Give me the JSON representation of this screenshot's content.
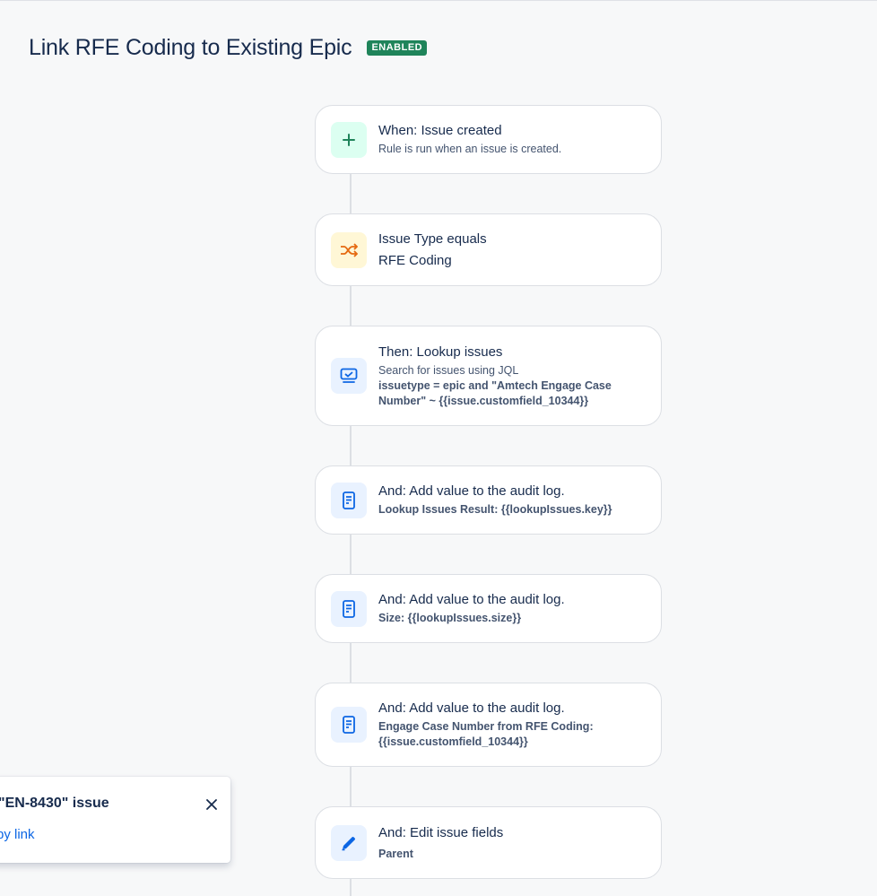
{
  "header": {
    "title": "Link RFE Coding to Existing Epic",
    "status_badge": "ENABLED"
  },
  "colors": {
    "badge": "#1f845a",
    "link": "#0c66e4",
    "trigger_icon": "#1f845a",
    "condition_icon": "#e56910",
    "action_icon": "#0c66e4"
  },
  "steps": [
    {
      "icon": "plus-icon",
      "title": "When: Issue created",
      "subtitle": "Rule is run when an issue is created."
    },
    {
      "icon": "shuffle-icon",
      "title": "Issue Type equals",
      "value": "RFE Coding"
    },
    {
      "icon": "lookup-icon",
      "title": "Then: Lookup issues",
      "subtitle": "Search for issues using JQL",
      "detail_1": "issuetype = epic and \"Amtech Engage Case",
      "detail_2": "Number\" ~ {{issue.customfield_10344}}"
    },
    {
      "icon": "audit-log-icon",
      "title": "And: Add value to the audit log.",
      "detail": "Lookup Issues Result: {{lookupIssues.key}}"
    },
    {
      "icon": "audit-log-icon",
      "title": "And: Add value to the audit log.",
      "detail": "Size: {{lookupIssues.size}}"
    },
    {
      "icon": "audit-log-icon",
      "title": "And: Add value to the audit log.",
      "detail_1": "Engage Case Number from RFE Coding:",
      "detail_2": "{{issue.customfield_10344}}"
    },
    {
      "icon": "pencil-icon",
      "title": "And: Edit issue fields",
      "detail": "Parent"
    }
  ],
  "flag": {
    "title": "\"EN-8430\" issue",
    "link": "py link",
    "close_icon": "close-icon"
  }
}
